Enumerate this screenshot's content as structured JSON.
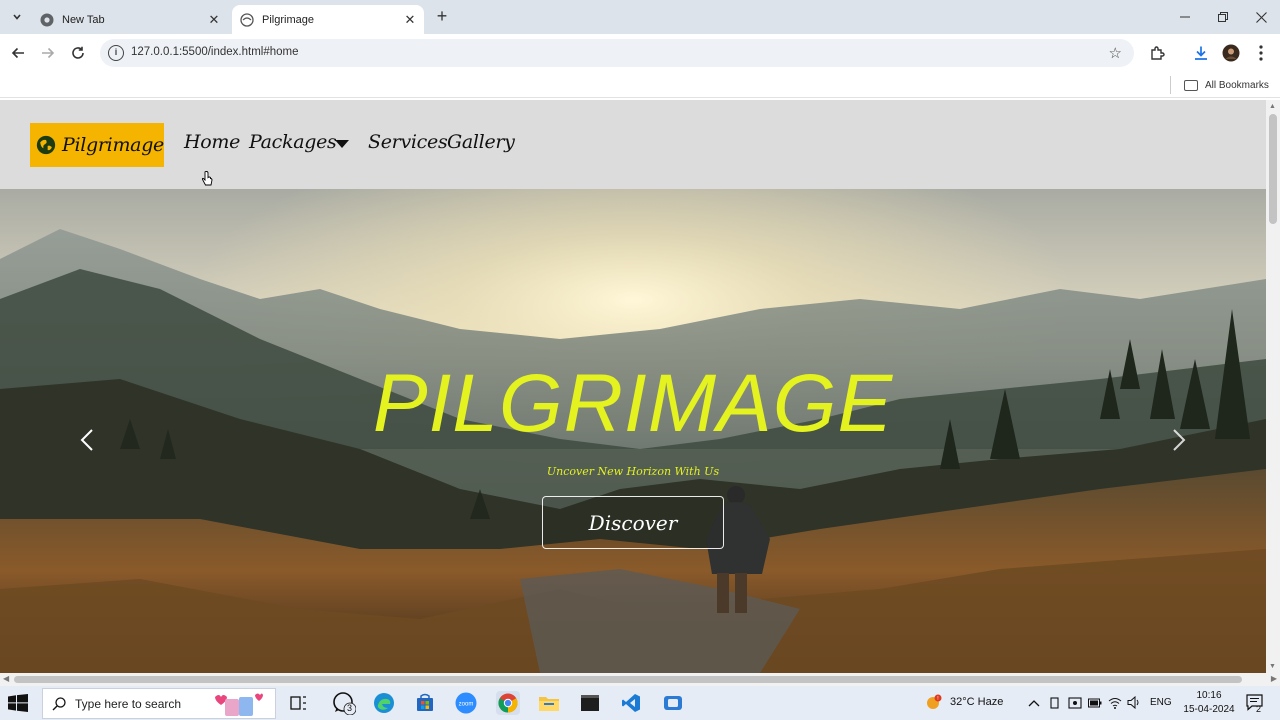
{
  "browser": {
    "tabs": [
      {
        "title": "New Tab",
        "active": false
      },
      {
        "title": "Pilgrimage",
        "active": true
      }
    ],
    "url": "127.0.0.1:5500/index.html#home",
    "bookmarks_label": "All Bookmarks"
  },
  "site": {
    "logo_text": "Pilgrimage",
    "nav": {
      "home": "Home",
      "packages": "Packages",
      "services": "Services",
      "gallery": "Gallery"
    },
    "hero": {
      "title": "PILGRIMAGE",
      "subtitle": "Uncover New Horizon With Us",
      "button": "Discover"
    },
    "colors": {
      "accent_yellow": "#e4f21f",
      "logo_bg": "#f4b400",
      "nav_bg": "#dcdcdc"
    }
  },
  "taskbar": {
    "search_placeholder": "Type here to search",
    "whatsapp_badge": "3",
    "weather": "32°C  Haze",
    "language": "ENG",
    "time": "10:16",
    "date": "15-04-2024",
    "notification_count": "2"
  }
}
